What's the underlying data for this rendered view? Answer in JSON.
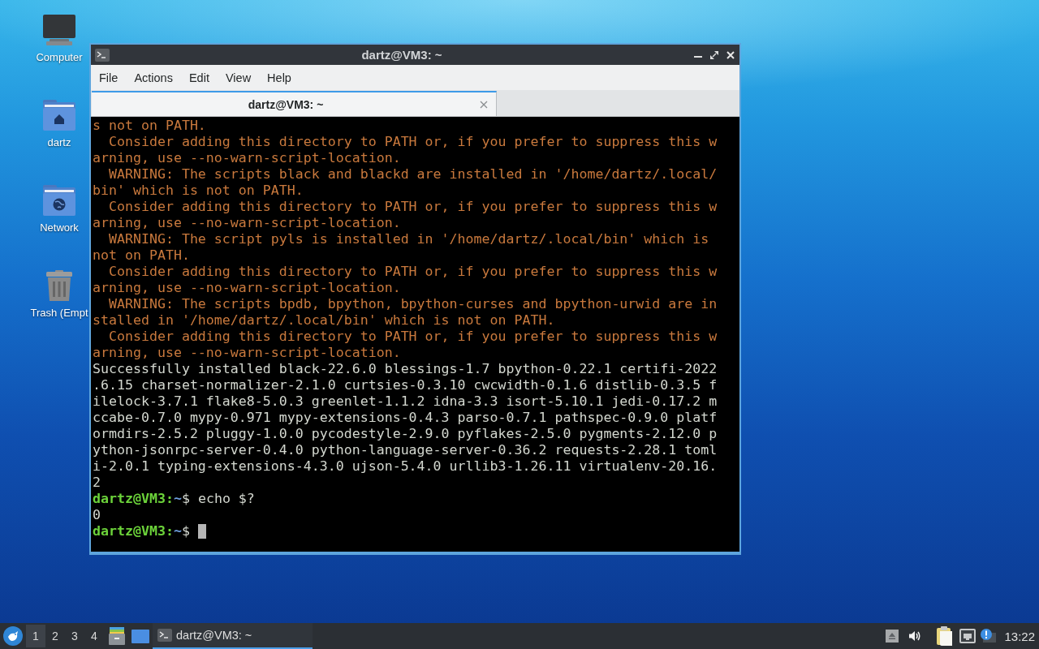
{
  "desktop_icons": [
    {
      "kind": "computer",
      "label": "Computer"
    },
    {
      "kind": "home",
      "label": "dartz"
    },
    {
      "kind": "network",
      "label": "Network"
    },
    {
      "kind": "trash",
      "label": "Trash (Empt"
    }
  ],
  "window": {
    "title": "dartz@VM3: ~",
    "menu": [
      "File",
      "Actions",
      "Edit",
      "View",
      "Help"
    ],
    "tabs": [
      {
        "label": "dartz@VM3: ~",
        "selected": true
      }
    ],
    "lines": [
      {
        "kind": "warning",
        "text": "s not on PATH."
      },
      {
        "kind": "warning",
        "text": "  Consider adding this directory to PATH or, if you prefer to suppress this w"
      },
      {
        "kind": "warning",
        "text": "arning, use --no-warn-script-location."
      },
      {
        "kind": "warning",
        "text": "  WARNING: The scripts black and blackd are installed in '/home/dartz/.local/"
      },
      {
        "kind": "warning",
        "text": "bin' which is not on PATH."
      },
      {
        "kind": "warning",
        "text": "  Consider adding this directory to PATH or, if you prefer to suppress this w"
      },
      {
        "kind": "warning",
        "text": "arning, use --no-warn-script-location."
      },
      {
        "kind": "warning",
        "text": "  WARNING: The script pyls is installed in '/home/dartz/.local/bin' which is"
      },
      {
        "kind": "warning",
        "text": "not on PATH."
      },
      {
        "kind": "warning",
        "text": "  Consider adding this directory to PATH or, if you prefer to suppress this w"
      },
      {
        "kind": "warning",
        "text": "arning, use --no-warn-script-location."
      },
      {
        "kind": "warning",
        "text": "  WARNING: The scripts bpdb, bpython, bpython-curses and bpython-urwid are in"
      },
      {
        "kind": "warning",
        "text": "stalled in '/home/dartz/.local/bin' which is not on PATH."
      },
      {
        "kind": "warning",
        "text": "  Consider adding this directory to PATH or, if you prefer to suppress this w"
      },
      {
        "kind": "warning",
        "text": "arning, use --no-warn-script-location."
      },
      {
        "kind": "output",
        "text": "Successfully installed black-22.6.0 blessings-1.7 bpython-0.22.1 certifi-2022"
      },
      {
        "kind": "output",
        "text": ".6.15 charset-normalizer-2.1.0 curtsies-0.3.10 cwcwidth-0.1.6 distlib-0.3.5 f"
      },
      {
        "kind": "output",
        "text": "ilelock-3.7.1 flake8-5.0.3 greenlet-1.1.2 idna-3.3 isort-5.10.1 jedi-0.17.2 m"
      },
      {
        "kind": "output",
        "text": "ccabe-0.7.0 mypy-0.971 mypy-extensions-0.4.3 parso-0.7.1 pathspec-0.9.0 platf"
      },
      {
        "kind": "output",
        "text": "ormdirs-2.5.2 pluggy-1.0.0 pycodestyle-2.9.0 pyflakes-2.5.0 pygments-2.12.0 p"
      },
      {
        "kind": "output",
        "text": "ython-jsonrpc-server-0.4.0 python-language-server-0.36.2 requests-2.28.1 toml"
      },
      {
        "kind": "output",
        "text": "i-2.0.1 typing-extensions-4.3.0 ujson-5.4.0 urllib3-1.26.11 virtualenv-20.16."
      },
      {
        "kind": "output",
        "text": "2"
      },
      {
        "kind": "prompt",
        "prompt": "dartz@VM3:",
        "path": "~",
        "symbol": "$",
        "command": "echo $?",
        "cursor": false
      },
      {
        "kind": "output",
        "text": "0"
      },
      {
        "kind": "prompt",
        "prompt": "dartz@VM3:",
        "path": "~",
        "symbol": "$",
        "cursor": true
      }
    ]
  },
  "taskbar": {
    "workspaces": [
      {
        "label": "1",
        "selected": true
      },
      {
        "label": "2",
        "selected": false
      },
      {
        "label": "3",
        "selected": false
      },
      {
        "label": "4",
        "selected": false
      }
    ],
    "tasks": [
      {
        "label": "dartz@VM3: ~",
        "selected": true
      }
    ],
    "clock": "13:22"
  }
}
